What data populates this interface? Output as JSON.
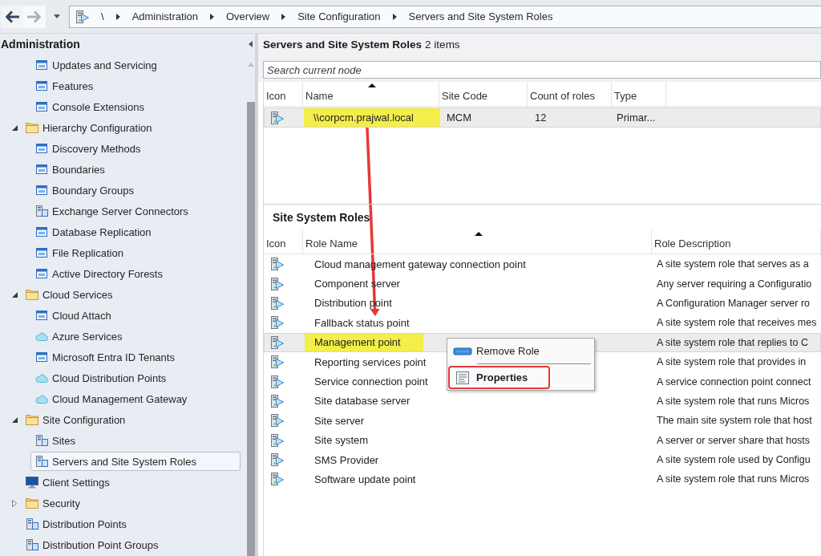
{
  "navigation": {
    "back": {
      "disabled": false
    },
    "forward": {
      "disabled": true
    }
  },
  "address_bar": {
    "breadcrumb": [
      "\\",
      "Administration",
      "Overview",
      "Site Configuration",
      "Servers and Site System Roles"
    ]
  },
  "navigation_pane": {
    "title": "Administration",
    "tree": {
      "continued": [
        {
          "label": "Updates and Servicing",
          "kind": "node",
          "selected": false
        },
        {
          "label": "Features",
          "kind": "node",
          "selected": false
        },
        {
          "label": "Console Extensions",
          "kind": "node",
          "selected": false
        }
      ],
      "items": [
        {
          "label": "Hierarchy Configuration",
          "kind": "folder",
          "expanded": true,
          "selected": false,
          "children": [
            {
              "label": "Discovery Methods",
              "kind": "node",
              "selected": false
            },
            {
              "label": "Boundaries",
              "kind": "node",
              "selected": false
            },
            {
              "label": "Boundary Groups",
              "kind": "node",
              "selected": false
            },
            {
              "label": "Exchange Server Connectors",
              "kind": "server",
              "selected": false
            },
            {
              "label": "Database Replication",
              "kind": "node",
              "selected": false
            },
            {
              "label": "File Replication",
              "kind": "node",
              "selected": false
            },
            {
              "label": "Active Directory Forests",
              "kind": "node",
              "selected": false
            }
          ]
        },
        {
          "label": "Cloud Services",
          "kind": "folder",
          "expanded": true,
          "selected": false,
          "children": [
            {
              "label": "Cloud Attach",
              "kind": "node",
              "selected": false
            },
            {
              "label": "Azure Services",
              "kind": "cloud",
              "selected": false
            },
            {
              "label": "Microsoft Entra ID Tenants",
              "kind": "node",
              "selected": false
            },
            {
              "label": "Cloud Distribution Points",
              "kind": "cloud",
              "selected": false
            },
            {
              "label": "Cloud Management Gateway",
              "kind": "cloud",
              "selected": false
            }
          ]
        },
        {
          "label": "Site Configuration",
          "kind": "folder",
          "expanded": true,
          "selected": false,
          "children": [
            {
              "label": "Sites",
              "kind": "server",
              "selected": false
            },
            {
              "label": "Servers and Site System Roles",
              "kind": "server",
              "selected": true
            }
          ]
        },
        {
          "label": "Client Settings",
          "kind": "monitor",
          "selected": false
        },
        {
          "label": "Security",
          "kind": "folder",
          "expanded": false,
          "selected": false
        },
        {
          "label": "Distribution Points",
          "kind": "server",
          "selected": false
        },
        {
          "label": "Distribution Point Groups",
          "kind": "server",
          "selected": false
        }
      ]
    }
  },
  "servers": {
    "title": "Servers and Site System Roles",
    "count": "2 items",
    "search": {
      "placeholder": "Search current node"
    },
    "columns": [
      {
        "label": "Icon",
        "sorted": false
      },
      {
        "label": "Name",
        "sorted": true
      },
      {
        "label": "Site Code",
        "sorted": false
      },
      {
        "label": "Count of roles",
        "sorted": false
      },
      {
        "label": "Type",
        "sorted": false
      }
    ],
    "rows": [
      {
        "name": "\\\\corpcm.prajwal.local",
        "site_code": "MCM",
        "count_of_roles": "12",
        "type": "Primar...",
        "selected": true,
        "highlighted": true
      }
    ]
  },
  "site_system_roles": {
    "title": "Site System Roles",
    "columns": [
      {
        "label": "Icon",
        "sorted": false
      },
      {
        "label": "Role Name",
        "sorted": true
      },
      {
        "label": "Role Description",
        "sorted": false
      }
    ],
    "rows": [
      {
        "role_name": "Cloud management gateway connection point",
        "description": "A site system role that serves as a",
        "selected": false,
        "highlighted": false
      },
      {
        "role_name": "Component server",
        "description": "Any server requiring a Configuratio",
        "selected": false,
        "highlighted": false
      },
      {
        "role_name": "Distribution point",
        "description": "A Configuration Manager server ro",
        "selected": false,
        "highlighted": false
      },
      {
        "role_name": "Fallback status point",
        "description": "A site system role that receives mes",
        "selected": false,
        "highlighted": false
      },
      {
        "role_name": "Management point",
        "description": "A site system role that replies to C",
        "selected": true,
        "highlighted": true
      },
      {
        "role_name": "Reporting services point",
        "description": "A site system role that provides in",
        "selected": false,
        "highlighted": false
      },
      {
        "role_name": "Service connection point",
        "description": "A service connection point connect",
        "selected": false,
        "highlighted": false
      },
      {
        "role_name": "Site database server",
        "description": "A site system role that runs Micros",
        "selected": false,
        "highlighted": false
      },
      {
        "role_name": "Site server",
        "description": "The main site system role that host",
        "selected": false,
        "highlighted": false
      },
      {
        "role_name": "Site system",
        "description": "A server or server share that hosts",
        "selected": false,
        "highlighted": false
      },
      {
        "role_name": "SMS Provider",
        "description": "A site system role used by Configu",
        "selected": false,
        "highlighted": false
      },
      {
        "role_name": "Software update point",
        "description": "A site system role that runs Micros",
        "selected": false,
        "highlighted": false
      }
    ]
  },
  "context_menu": {
    "items": [
      {
        "label": "Remove Role",
        "kind": "remove",
        "default": false,
        "outlined": false
      },
      {
        "label": "Properties",
        "kind": "properties",
        "default": true,
        "outlined": true
      }
    ]
  },
  "arrow_annotation": true
}
